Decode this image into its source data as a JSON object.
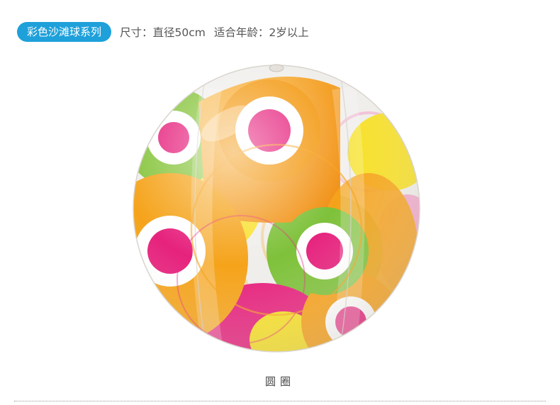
{
  "header": {
    "series_label": "彩色沙滩球系列",
    "size_text": "尺寸：直径50cm",
    "age_text": "适合年龄：2岁以上"
  },
  "product": {
    "image_icon": "beach-ball-icon",
    "caption": "圆圈"
  },
  "colors": {
    "pill_background": "#1ea0da",
    "orange": "#f7a11a",
    "magenta": "#e6227d",
    "green": "#7ec13a",
    "yellow": "#f7e027"
  }
}
